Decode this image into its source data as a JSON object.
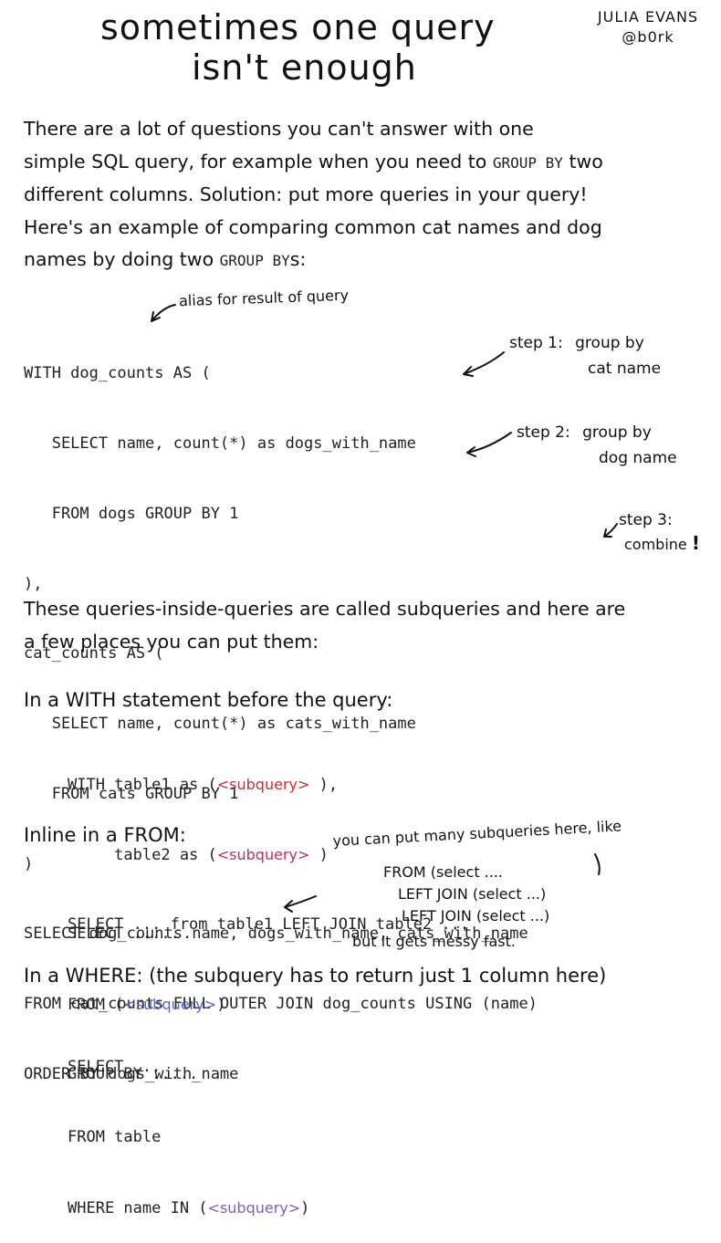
{
  "title": {
    "line1": "sometimes one query",
    "line2": "isn't enough"
  },
  "author": {
    "name": "JULIA EVANS",
    "handle": "@b0rk"
  },
  "intro": {
    "l1": "There are a lot of questions you can't answer with one",
    "l2a": "simple SQL query, for example when you need to",
    "l2kw": "GROUP BY",
    "l2b": "two",
    "l3": "different columns. Solution: put more queries in your query!",
    "l4": "Here's an example of comparing common cat names and dog",
    "l5a": "names by doing two",
    "l5kw": "GROUP BY",
    "l5b": "s:"
  },
  "example": {
    "alias_note": "alias for result of query",
    "code": [
      "WITH dog_counts AS (",
      "   SELECT name, count(*) as dogs_with_name",
      "   FROM dogs GROUP BY 1",
      "),",
      "cat_counts AS (",
      "   SELECT name, count(*) as cats_with_name",
      "   FROM cats GROUP BY 1",
      ")",
      "SELECT dog_counts.name, dogs_with_name, cats_with_name",
      "FROM cat_counts FULL OUTER JOIN dog_counts USING (name)",
      "ORDER BY dogs_with_name"
    ],
    "step1": {
      "label": "step 1:",
      "desc1": "group by",
      "desc2": "cat name"
    },
    "step2": {
      "label": "step 2:",
      "desc1": "group by",
      "desc2": "dog name"
    },
    "step3": {
      "label": "step 3:",
      "desc": "combine",
      "bang": "!"
    }
  },
  "subqueries_text": {
    "l1": "These queries-inside-queries are called subqueries and here are",
    "l2": "a few places you can put them:"
  },
  "with_section": {
    "heading": "In a WITH statement before the query:",
    "l1a": "WITH table1 as (",
    "l1sub": "<subquery>",
    "l1b": " ),",
    "l2a": "     table2 as (",
    "l2sub": "<subquery>",
    "l2b": " )",
    "l3": "SELECT ... from table1 LEFT JOIN table2 ..."
  },
  "from_section": {
    "heading": "Inline in a FROM:",
    "l1": "SELECT .....",
    "l2a": "FROM (",
    "l2sub": "<subquery>",
    "l2b": ")",
    "l3": "GROUP BY .....",
    "note": {
      "l1": "you can put many subqueries here, like",
      "l2": "FROM (select ....",
      "l3": "LEFT JOIN (select ...)",
      "l4": "LEFT JOIN (select ...)",
      "l5": "but it gets messy fast."
    }
  },
  "where_section": {
    "heading": "In a WHERE: (the subquery has to return just 1 column here)",
    "l1": "SELECT ...",
    "l2": "FROM table",
    "l3a": "WHERE name IN (",
    "l3sub": "<subquery>",
    "l3b": ")"
  }
}
